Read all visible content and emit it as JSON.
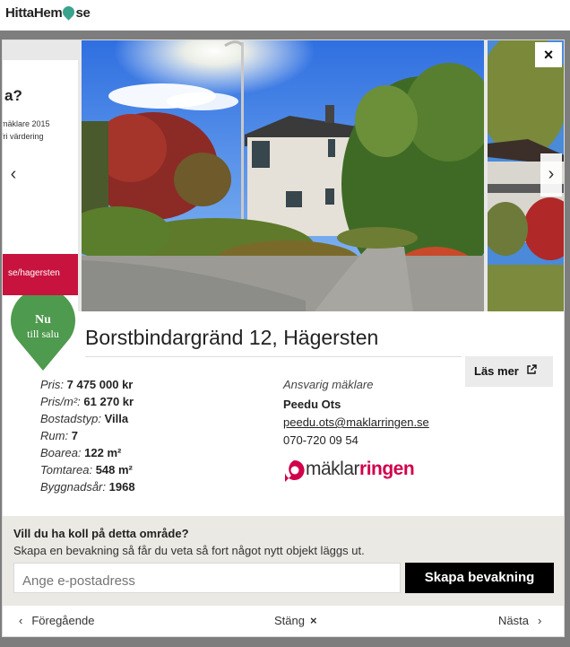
{
  "site": {
    "logo_text_a": "HittaHem",
    "logo_text_b": "se"
  },
  "ad": {
    "question": "a?",
    "line1": "mäklare 2015",
    "line2": "fri värdering",
    "cta": "se/hagersten",
    "color": "#c7133e"
  },
  "gallery": {
    "prev_icon": "chevron-left-icon",
    "next_icon": "chevron-right-icon",
    "close_glyph": "×"
  },
  "badge": {
    "line1": "Nu",
    "line2": "till salu",
    "color": "#4e9a4e"
  },
  "listing": {
    "address": "Borstbindargränd 12, Hägersten",
    "read_more": "Läs mer",
    "facts": [
      {
        "label": "Pris:",
        "value": "7 475 000 kr"
      },
      {
        "label": "Pris/m²:",
        "value": "61 270 kr"
      },
      {
        "label": "Bostadstyp:",
        "value": "Villa"
      },
      {
        "label": "Rum:",
        "value": "7"
      },
      {
        "label": "Boarea:",
        "value": "122 m²"
      },
      {
        "label": "Tomtarea:",
        "value": "548 m²"
      },
      {
        "label": "Byggnadsår:",
        "value": "1968"
      }
    ]
  },
  "agent": {
    "role": "Ansvarig mäklare",
    "name": "Peedu Ots",
    "email": "peedu.ots@maklarringen.se",
    "phone": "070-720 09 54",
    "brand_a": "mäklar",
    "brand_b": "ringen",
    "brand_color": "#d0004a"
  },
  "watch": {
    "title": "Vill du ha koll på detta område?",
    "subtitle": "Skapa en bevakning så får du veta så fort något nytt objekt läggs ut.",
    "placeholder": "Ange e-postadress",
    "button": "Skapa bevakning"
  },
  "footer": {
    "prev": "Föregående",
    "close": "Stäng",
    "next": "Nästa"
  }
}
